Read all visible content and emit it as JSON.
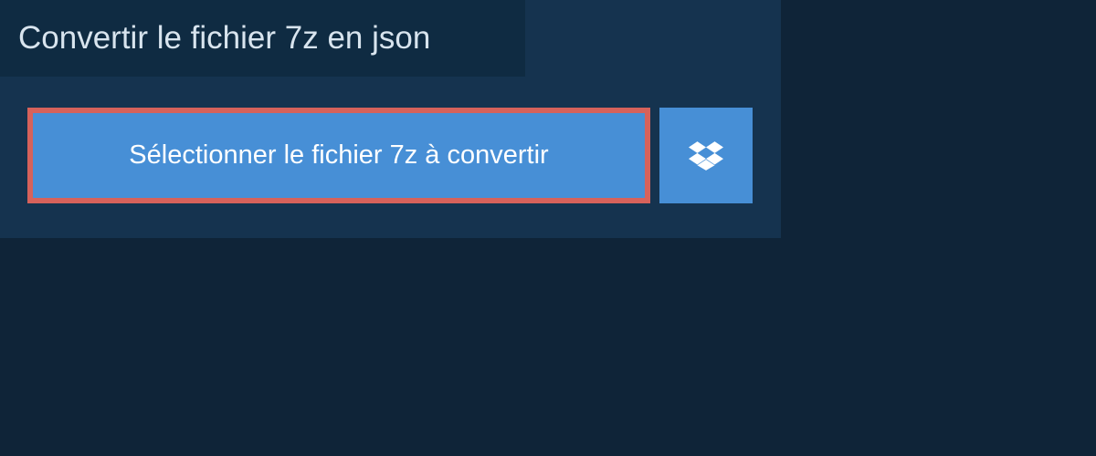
{
  "header": {
    "title": "Convertir le fichier 7z en json"
  },
  "actions": {
    "select_file_label": "Sélectionner le fichier 7z à convertir",
    "dropbox_icon": "dropbox-icon"
  },
  "colors": {
    "page_bg": "#0f2438",
    "panel_bg": "#15334f",
    "heading_bg": "#0f2b42",
    "button_bg": "#478fd6",
    "button_border": "#d6625b",
    "text_light": "#d8e4ee",
    "text_white": "#ffffff"
  }
}
